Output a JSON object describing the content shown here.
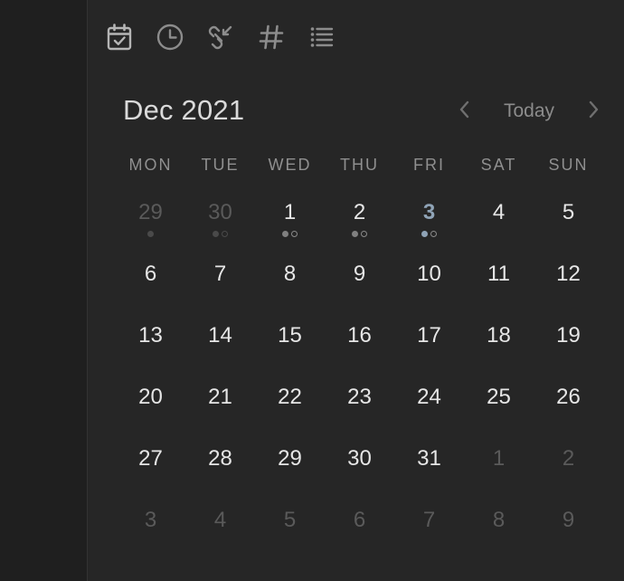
{
  "toolbar": {
    "icons": [
      "calendar-check-icon",
      "clock-icon",
      "link-icon",
      "hashtag-icon",
      "list-icon"
    ]
  },
  "header": {
    "month_title": "Dec 2021",
    "today_label": "Today"
  },
  "weekdays": [
    "MON",
    "TUE",
    "WED",
    "THU",
    "FRI",
    "SAT",
    "SUN"
  ],
  "colors": {
    "today": "#8fa3b6",
    "dot_filled_muted": "#4a4a4a",
    "dot_filled": "#808080",
    "dot_today": "#8fa3b6",
    "dot_outline": "#8a8a8a"
  },
  "weeks": [
    [
      {
        "label": "29",
        "muted": true,
        "dots": [
          "filled-muted"
        ]
      },
      {
        "label": "30",
        "muted": true,
        "dots": [
          "filled-muted",
          "outline-muted"
        ]
      },
      {
        "label": "1",
        "dots": [
          "filled",
          "outline"
        ]
      },
      {
        "label": "2",
        "dots": [
          "filled",
          "outline"
        ]
      },
      {
        "label": "3",
        "today": true,
        "dots": [
          "filled-today",
          "outline"
        ]
      },
      {
        "label": "4"
      },
      {
        "label": "5"
      }
    ],
    [
      {
        "label": "6"
      },
      {
        "label": "7"
      },
      {
        "label": "8"
      },
      {
        "label": "9"
      },
      {
        "label": "10"
      },
      {
        "label": "11"
      },
      {
        "label": "12"
      }
    ],
    [
      {
        "label": "13"
      },
      {
        "label": "14"
      },
      {
        "label": "15"
      },
      {
        "label": "16"
      },
      {
        "label": "17"
      },
      {
        "label": "18"
      },
      {
        "label": "19"
      }
    ],
    [
      {
        "label": "20"
      },
      {
        "label": "21"
      },
      {
        "label": "22"
      },
      {
        "label": "23"
      },
      {
        "label": "24"
      },
      {
        "label": "25"
      },
      {
        "label": "26"
      }
    ],
    [
      {
        "label": "27"
      },
      {
        "label": "28"
      },
      {
        "label": "29"
      },
      {
        "label": "30"
      },
      {
        "label": "31"
      },
      {
        "label": "1",
        "muted": true
      },
      {
        "label": "2",
        "muted": true
      }
    ],
    [
      {
        "label": "3",
        "muted": true
      },
      {
        "label": "4",
        "muted": true
      },
      {
        "label": "5",
        "muted": true
      },
      {
        "label": "6",
        "muted": true
      },
      {
        "label": "7",
        "muted": true
      },
      {
        "label": "8",
        "muted": true
      },
      {
        "label": "9",
        "muted": true
      }
    ]
  ]
}
